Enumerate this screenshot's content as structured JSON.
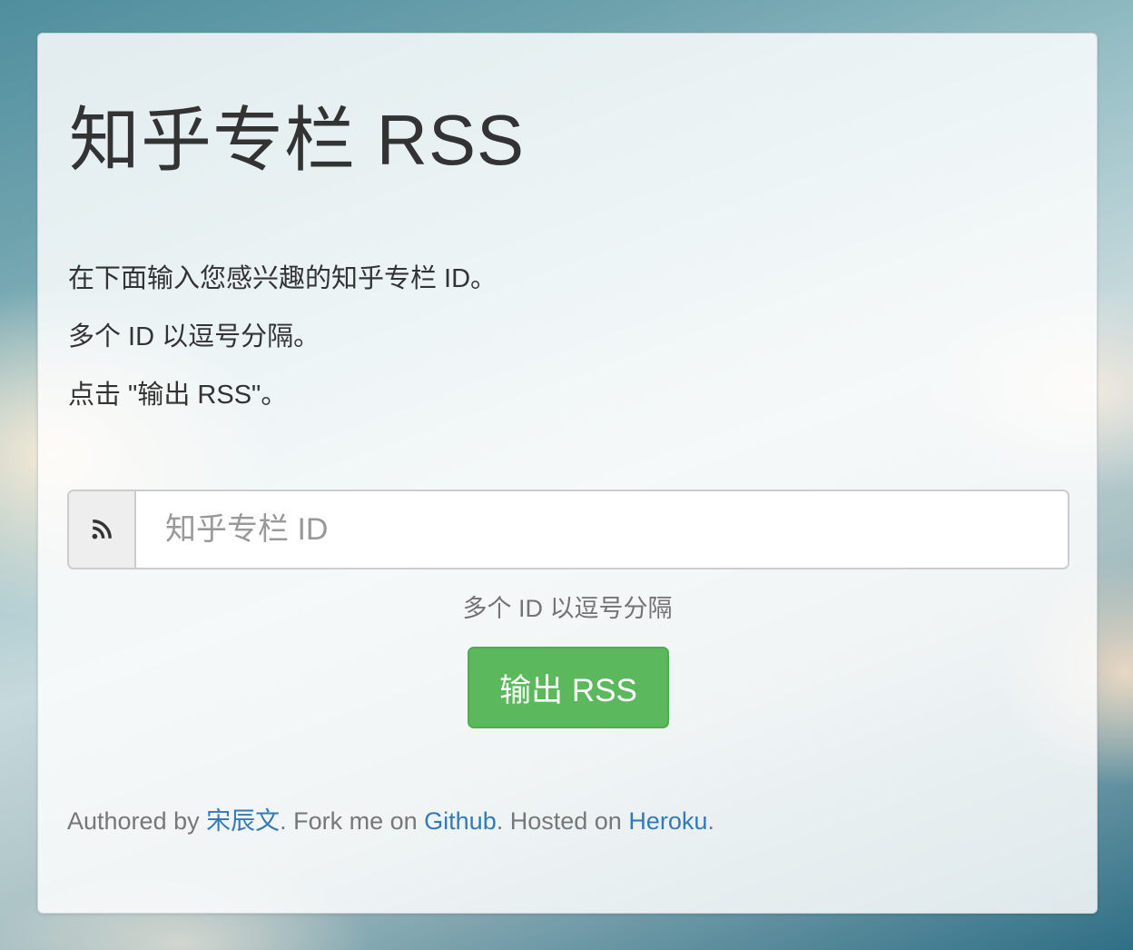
{
  "page": {
    "title": "知乎专栏 RSS",
    "instructions": [
      "在下面输入您感兴趣的知乎专栏 ID。",
      "多个 ID 以逗号分隔。",
      "点击 \"输出 RSS\"。"
    ]
  },
  "form": {
    "addon_icon": "rss-icon",
    "input_placeholder": "知乎专栏 ID",
    "input_value": "",
    "help_text": "多个 ID 以逗号分隔",
    "submit_label": "输出 RSS"
  },
  "footer": {
    "authored_prefix": "Authored by ",
    "author_link": "宋辰文",
    "fork_prefix": ". Fork me on ",
    "github_link": "Github",
    "hosted_prefix": ". Hosted on ",
    "heroku_link": "Heroku",
    "end": "."
  },
  "colors": {
    "submit_button": "#5cb85c",
    "link": "#337ab7",
    "title_text": "#333333"
  }
}
